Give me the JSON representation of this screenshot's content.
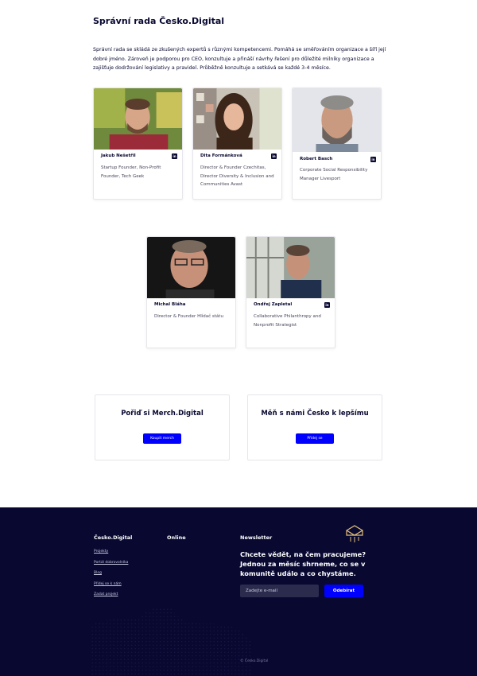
{
  "section": {
    "title": "Správní rada Česko.Digital",
    "description": "Správní rada se skládá ze zkušených expertů s různými kompetencemi. Pomáhá se směřováním organizace a šíří její dobré jméno. Zároveň je podporou pro CEO, konzultuje a přináší návrhy řešení pro důležité milníky organizace a zajišťuje dodržování legislativy a pravidel. Průběžně konzultuje a setkává se každé 3-4 měsíce."
  },
  "members": [
    {
      "name": "Jakub Nešetřil",
      "role": "Startup Founder, Non-Profit Founder, Tech Geek",
      "linkedin_icon": "in"
    },
    {
      "name": "Dita Formánková",
      "role": "Director & Founder Czechitas, Director Diversity & Inclusion and Communities Avast",
      "linkedin_icon": "in"
    },
    {
      "name": "Robert Basch",
      "role": "Corporate Social Responsibility Manager Livesport",
      "linkedin_icon": "in"
    },
    {
      "name": "Michal Bláha",
      "role": "Director & Founder Hlídač státu",
      "linkedin_icon": ""
    },
    {
      "name": "Ondřej Zapletal",
      "role": "Collaborative Philanthropy and Nonprofit Strategist",
      "linkedin_icon": "in"
    }
  ],
  "cta": {
    "merch": {
      "title": "Pořiď si Merch.Digital",
      "button": "Koupit merch"
    },
    "join": {
      "title": "Měň s námi Česko k lepšímu",
      "button": "Přidej se"
    }
  },
  "footer": {
    "col1_title": "Česko.Digital",
    "col2_title": "Online",
    "links": [
      "Projekty",
      "Portál dobrovolníka",
      "Blog",
      "Přidej se k nám",
      "Zadat projekt"
    ],
    "newsletter": {
      "title": "Newsletter",
      "text": "Chcete vědět, na čem pracujeme? Jednou za měsíc shrneme, co se v komunitě událo a co chystáme.",
      "placeholder": "Zadejte e-mail",
      "button": "Odebírat"
    },
    "copyright": "© Česko.Digital",
    "colors": {
      "background": "#080831",
      "accent": "#0000ff"
    }
  }
}
